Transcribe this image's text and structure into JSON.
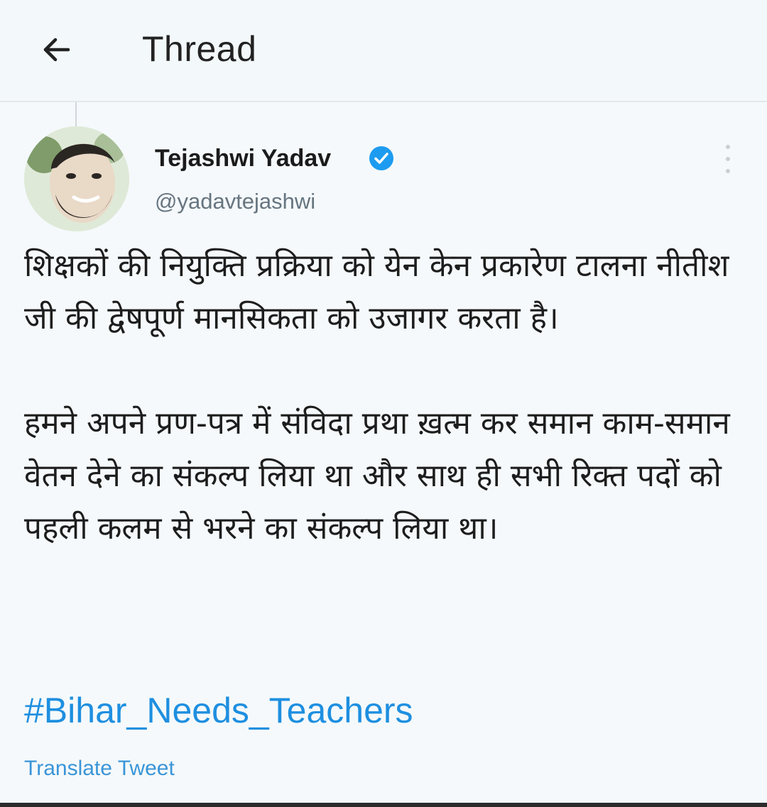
{
  "header": {
    "title": "Thread",
    "back_icon": "arrow-left-icon"
  },
  "tweet": {
    "author_name": "Tejashwi Yadav",
    "author_handle": "@yadavtejashwi",
    "verified_icon": "verified-badge-icon",
    "more_icon": "more-vertical-icon",
    "paragraph_1": "शिक्षकों की नियुक्ति प्रक्रिया को येन केन प्रकारेण टालना नीतीश जी की द्वेषपूर्ण मानसिकता को उजागर करता है।",
    "paragraph_2": "हमने अपने प्रण-पत्र में संविदा प्रथा ख़त्म कर समान काम-समान वेतन देने का संकल्प लिया था और साथ ही सभी रिक्त पदों को पहली कलम से भरने का संकल्प लिया था।",
    "hashtag": "#Bihar_Needs_Teachers",
    "translate_label": "Translate Tweet"
  },
  "colors": {
    "link": "#1e8fe0",
    "verified": "#1d9bf0",
    "background": "#f5f9fb"
  }
}
